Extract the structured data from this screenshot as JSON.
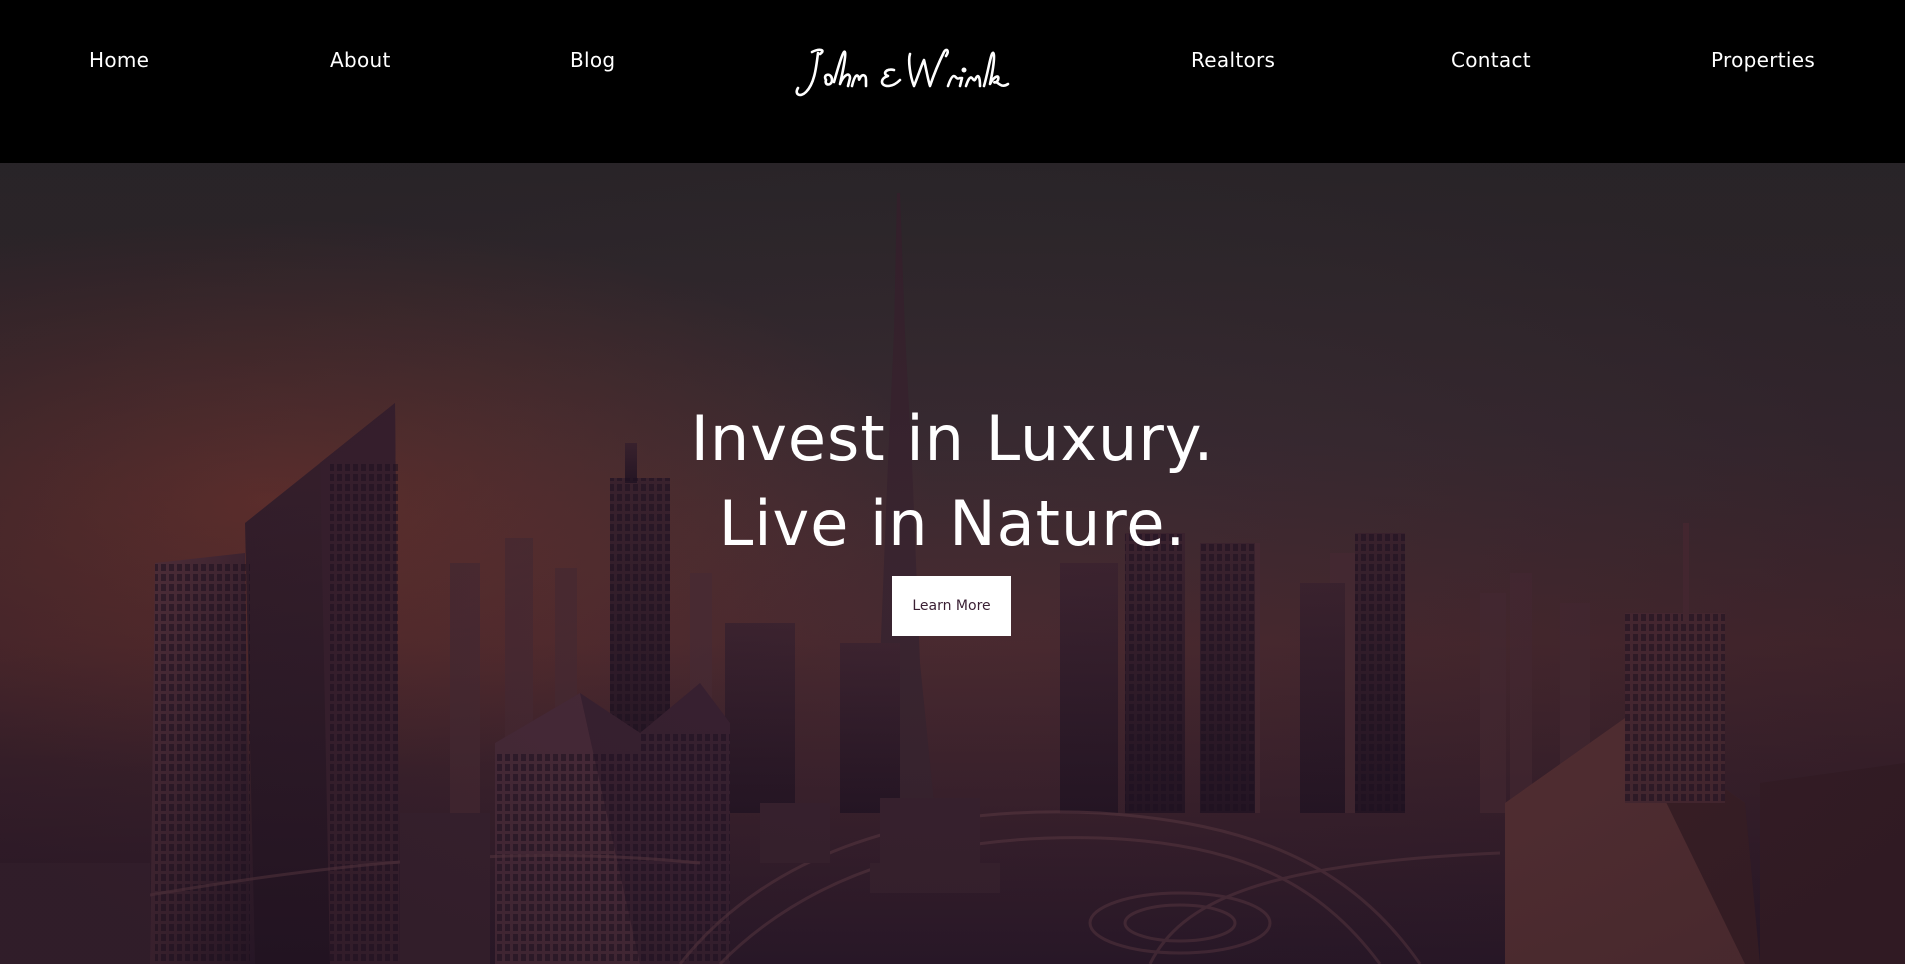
{
  "nav": {
    "home": "Home",
    "about": "About",
    "blog": "Blog",
    "realtors": "Realtors",
    "contact": "Contact",
    "properties": "Properties"
  },
  "logo": {
    "text": "John & Wrink"
  },
  "hero": {
    "headline_line1": "Invest in Luxury.",
    "headline_line2": "Live in Nature.",
    "cta_label": "Learn More"
  },
  "colors": {
    "header_bg": "#000000",
    "hero_tint": "#46262f",
    "cta_bg": "#ffffff",
    "cta_text": "#3a1f33"
  }
}
